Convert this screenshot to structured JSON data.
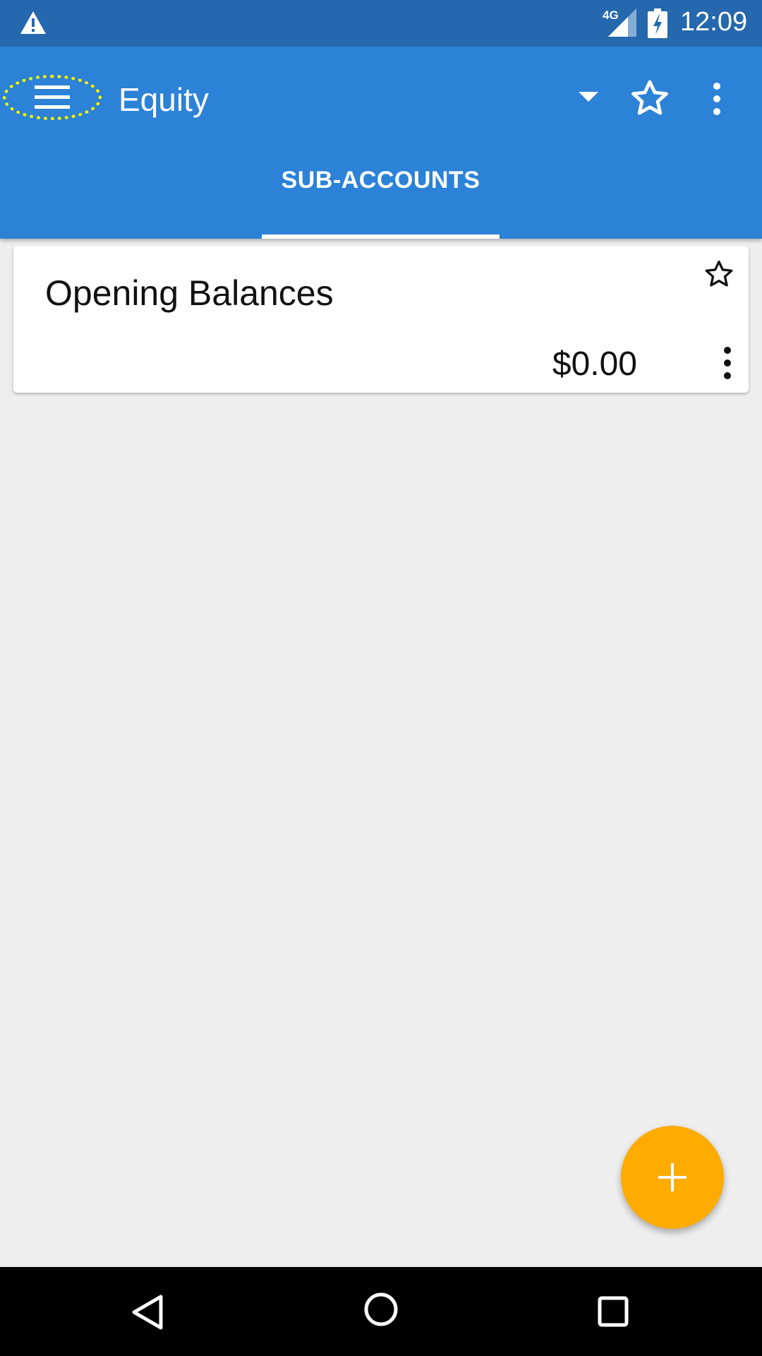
{
  "status_bar": {
    "network_label": "4G",
    "time": "12:09",
    "icons": [
      "warning-icon",
      "signal-icon",
      "battery-charging-icon"
    ]
  },
  "app_bar": {
    "title": "Equity",
    "icons": [
      "menu-icon",
      "dropdown-arrow-icon",
      "star-outline-icon",
      "more-vert-icon"
    ],
    "tabs": [
      {
        "label": "SUB-ACCOUNTS",
        "selected": true
      }
    ]
  },
  "accounts": [
    {
      "name": "Opening Balances",
      "balance": "$0.00",
      "favorite": false
    }
  ],
  "fab": {
    "icon": "add-icon"
  },
  "nav_bar": {
    "icons": [
      "back-icon",
      "home-icon",
      "recents-icon"
    ]
  },
  "colors": {
    "status_bar": "#2568AD",
    "app_bar": "#2B82D6",
    "background": "#EEEEEE",
    "fab": "#FFAB00",
    "highlight": "#F4F200"
  }
}
